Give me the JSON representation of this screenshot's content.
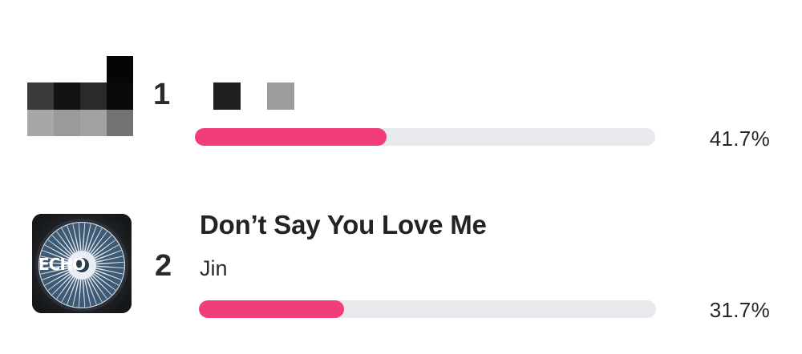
{
  "ranking": [
    {
      "rank": "1",
      "title": "",
      "artist": "",
      "percent_label": "41.7%",
      "percent_value": 41.7,
      "artwork_icon": "censored-album-artwork-icon",
      "pixel_colors": [
        "#ffffff",
        "#ffffff",
        "#ffffff",
        "#050505",
        "#3a3a3a",
        "#121212",
        "#2a2a2a",
        "#0a0a0a",
        "#a7a7a7",
        "#9a9a9a",
        "#a2a2a2",
        "#737373"
      ],
      "title_block_colors": [
        "#1e201f",
        "#9c9d9f"
      ]
    },
    {
      "rank": "2",
      "title": "Don’t Say You Love Me",
      "artist": "Jin",
      "percent_label": "31.7%",
      "percent_value": 31.7,
      "artwork_icon": "echo-album-artwork-icon",
      "artwork_text": "ECHO"
    }
  ],
  "colors": {
    "accent": "#f23d7c",
    "track": "#e8e9ed",
    "text": "#232323"
  }
}
